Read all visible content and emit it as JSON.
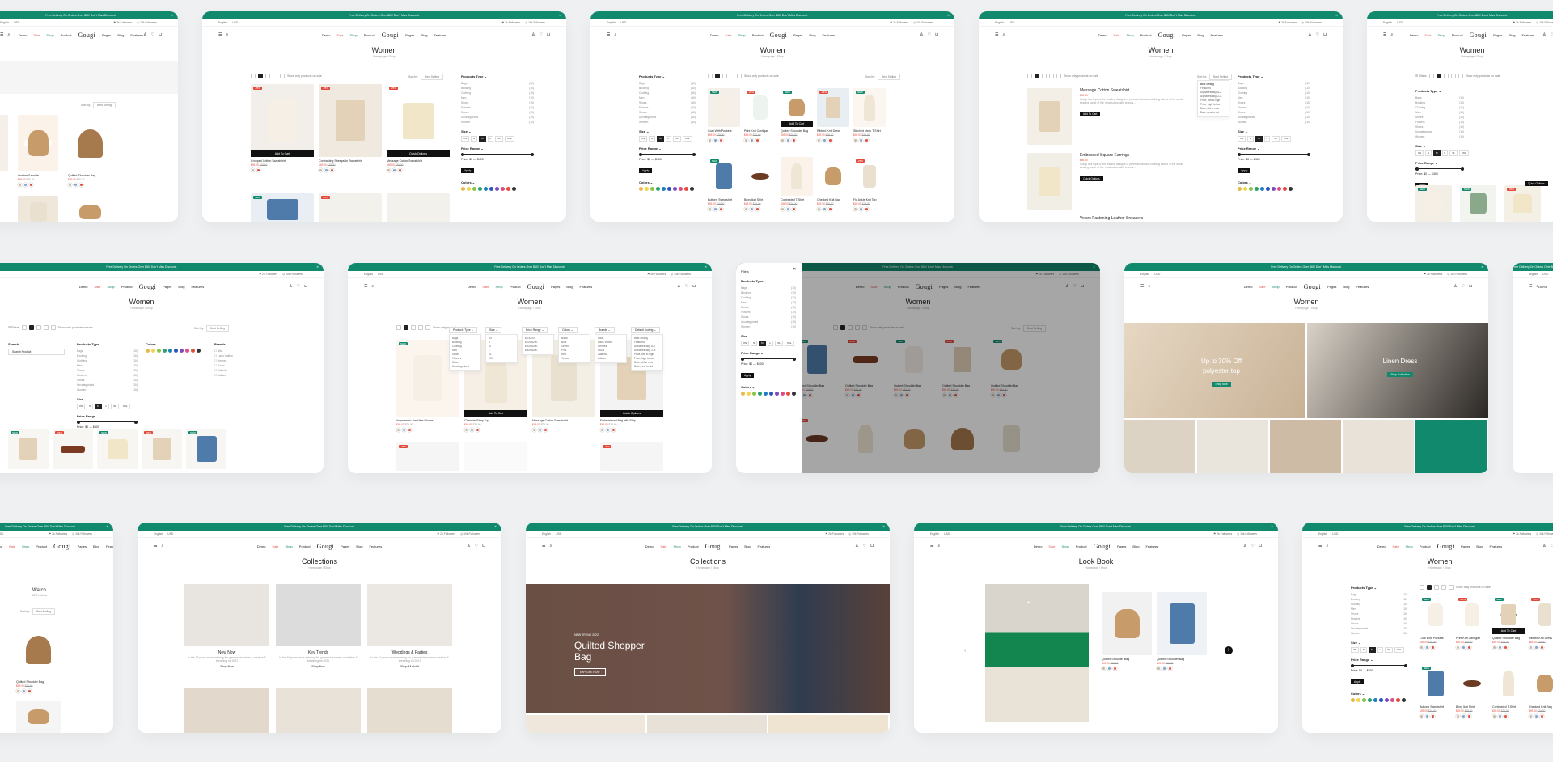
{
  "store": {
    "announcement": "Free Delivery On Orders Over $60! Don't Miss Discount.",
    "follow_a": "2k Followers",
    "follow_b": "10k Followers",
    "language": "English",
    "currency": "USD",
    "logo": "Gougi",
    "menu": [
      "Demo",
      "Sale",
      "Shop",
      "Product",
      "Pages",
      "Blog",
      "Features"
    ]
  },
  "pages": {
    "women": "Women",
    "collections": "Collections",
    "lookbook": "Look Book",
    "crumb_shop": "Homepage / Shop",
    "crumb_col": "Homepage / Shop",
    "crumb_look": "Homepage / Shop"
  },
  "toolbar": {
    "showing": "Show only products on sale",
    "sort_by": "Sort by:",
    "best_selling": "Best Selling",
    "filters": "Filters",
    "default_sorting": "Default Sorting"
  },
  "filters": {
    "products_type": "Products Type",
    "types": [
      "Bags",
      "Booking",
      "Clothing",
      "Men",
      "Shoes",
      "Flowers",
      "Shoes",
      "Uncategorized",
      "Women"
    ],
    "counts": [
      "(10)",
      "(10)",
      "(10)",
      "(10)",
      "(10)",
      "(10)",
      "(10)",
      "(10)",
      "(10)"
    ],
    "size": "Size",
    "sizes": [
      "XS",
      "S",
      "M",
      "L",
      "XL",
      "XXL"
    ],
    "price_range": "Price Range",
    "price_text": "Price: $0 — $400",
    "apply": "Apply",
    "colors": "Colors",
    "brands": "Brands",
    "brand_list": [
      "Nike",
      "Louis Vuitton",
      "Hermes",
      "Gucci",
      "Zalando",
      "Adidas"
    ],
    "search": "Search",
    "search_placeholder": "Search Product",
    "color_hex": [
      "#e8b94a",
      "#f0d54e",
      "#8bc34a",
      "#27a36b",
      "#1f7dc2",
      "#2b56b8",
      "#7b4bc2",
      "#e24b82",
      "#e64b3b",
      "#333333"
    ]
  },
  "products": {
    "cropped": "Cropped Cotton Sweatshirt",
    "contrasting": "Contrasting Sheepskin Sweatshirt",
    "message": "Message Cotton Sweatshirt",
    "coat": "Coat With Pockets",
    "printknit": "Print Knit Cardigan",
    "quilted": "Quilted Shoulder Bag",
    "ribbed": "Ribbed Knit Dress",
    "stitched": "Stitched Neck T-Shirt",
    "buttons": "Buttons Sweatshirt",
    "boxy": "Boxy Ikat Shirt",
    "combo": "Contrasted T-Shirt",
    "cheered": "Checked Knit Bag",
    "trousers": "Fly Ankle Knit Top",
    "embossed": "Embossed Square Earrings",
    "velcro": "Velcro Fastening Leather Sneakers",
    "leather_sandals": "Leather Sandals",
    "asym": "Asymmetric Neckline Blouse",
    "chamois": "Chamois Strap Top",
    "embroidered": "Embroidered Bag with Strip",
    "bucket": "Quilted Shoulder Bag",
    "price_a": "$49.00",
    "price_b": "$89.00",
    "price_old": "$79.00",
    "sale": "-25%",
    "new": "NEW",
    "add_to_cart": "Add To Cart",
    "quick_view": "Quick View",
    "quick_options": "Quick Options",
    "desc": "Gougi is a type of the leading designs of premium fashion clothing stores in the world, beating some of the most successful brands..."
  },
  "sortmenu": [
    "Best Selling",
    "Featured",
    "Alphabetically, A-Z",
    "Alphabetically, Z-A",
    "Price, low to high",
    "Price, high to low",
    "Date, old to new",
    "Date, new to old"
  ],
  "collections": {
    "new_now": "New Now",
    "key_trends": "Key Trends",
    "weddings": "Weddings & Parties",
    "blurb": "In the 16 years since entering the garment business a creative & breathing lot 2021",
    "shop_now": "Shop Now",
    "shop_all": "Shop All Outfit",
    "hero_kicker": "NEW TREND 2022",
    "hero_title": "Quilted Shopper Bag",
    "hero_btn": "EXPLORE NOW"
  },
  "banner": {
    "up_to": "Up to 30% Off",
    "polyester": "polyester top",
    "linen": "Linen Dress",
    "shop_now": "Shop Now",
    "shop_collection": "Shop Collection"
  },
  "watch": {
    "title": "Watch",
    "count": "22 Products"
  }
}
